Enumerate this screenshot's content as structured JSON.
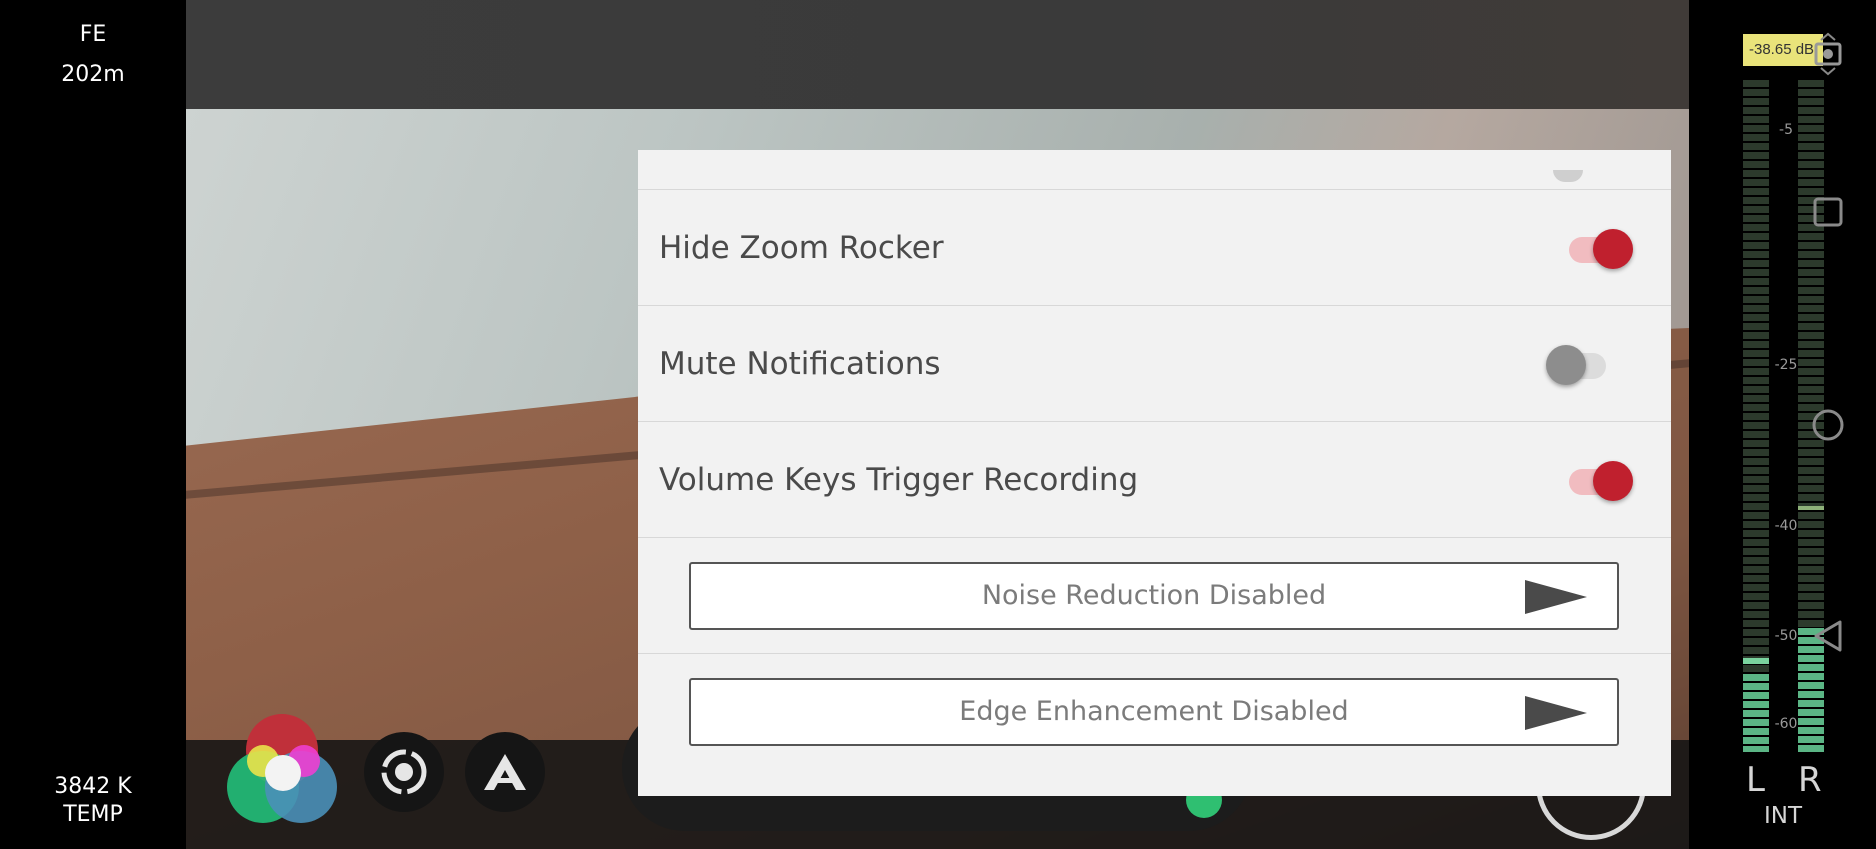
{
  "left_info": {
    "lens": "FE",
    "distance": "202m",
    "white_balance_value": "3842 K",
    "white_balance_label": "TEMP"
  },
  "settings_panel": {
    "toggles": [
      {
        "label": "Hide Zoom Rocker",
        "state": "on"
      },
      {
        "label": "Mute Notifications",
        "state": "off"
      },
      {
        "label": "Volume Keys Trigger Recording",
        "state": "on"
      }
    ],
    "actions": [
      {
        "label": "Noise Reduction Disabled"
      },
      {
        "label": "Edge Enhancement Disabled"
      }
    ]
  },
  "audio": {
    "level_readout": "-38.65 dB",
    "ticks": [
      "-5",
      "-25",
      "-40",
      "-50",
      "-60"
    ],
    "left_label": "L",
    "right_label": "R",
    "source_label": "INT"
  },
  "colors": {
    "accent_on": "#c0202e",
    "toggle_off": "#8d8d8d",
    "meter_green": "#5bb585",
    "db_badge": "#e9e37a"
  },
  "icons": {
    "nav": [
      "camera-switch-icon",
      "square-icon",
      "circle-icon",
      "back-triangle-icon"
    ],
    "controls": [
      "color-wheel-icon",
      "exposure-icon",
      "auto-mode-icon"
    ],
    "action_arrow": "play-arrow-icon"
  }
}
